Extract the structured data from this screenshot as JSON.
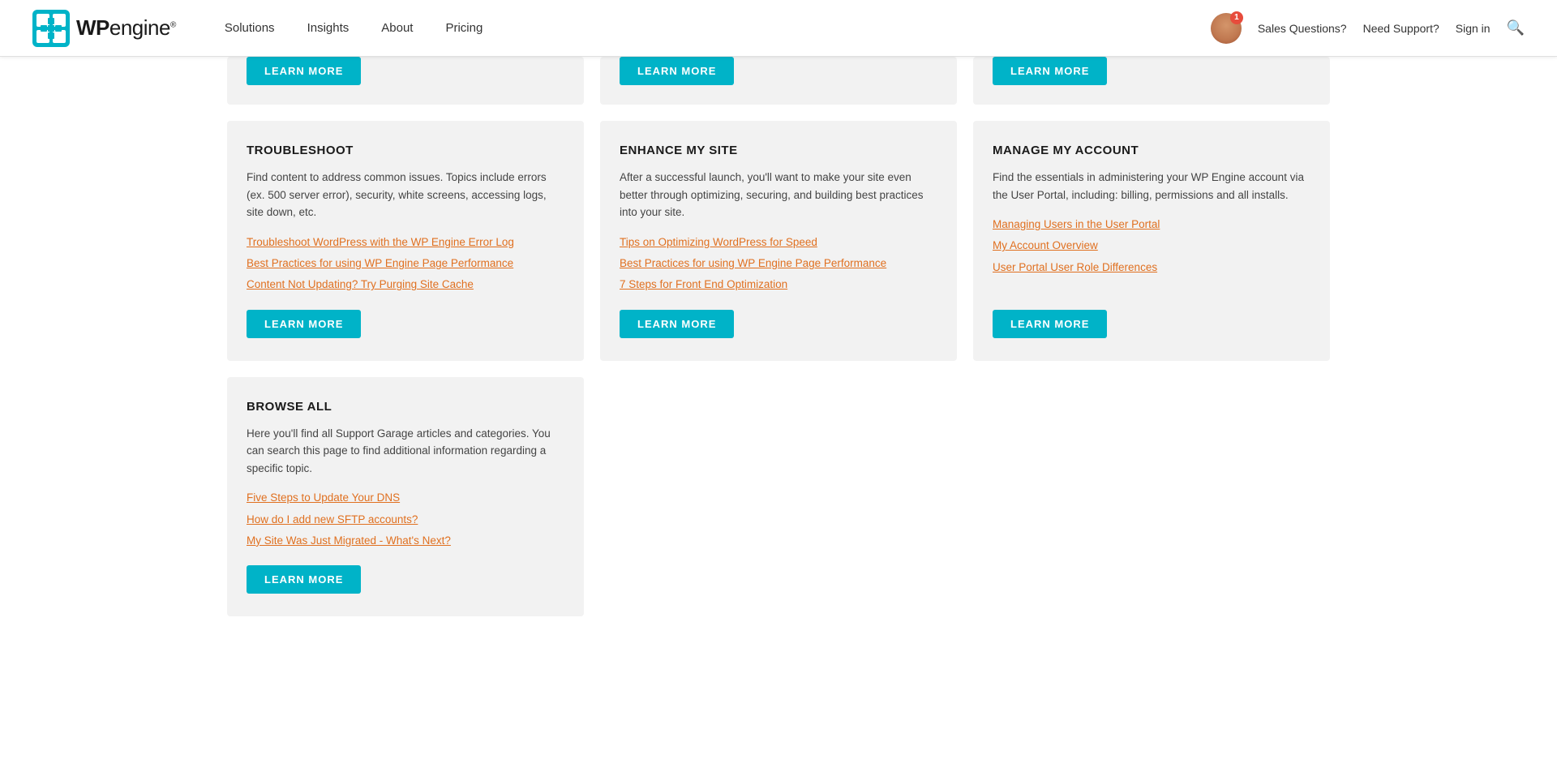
{
  "header": {
    "logo_text_wp": "WP",
    "logo_text_engine": "engine",
    "logo_tagline": "®",
    "nav": [
      {
        "label": "Solutions",
        "href": "#"
      },
      {
        "label": "Insights",
        "href": "#"
      },
      {
        "label": "About",
        "href": "#"
      },
      {
        "label": "Pricing",
        "href": "#"
      }
    ],
    "badge_count": "1",
    "sales_questions": "Sales Questions?",
    "need_support": "Need Support?",
    "sign_in": "Sign in"
  },
  "partial_cards": [
    {
      "btn_label": "LEARN MORE"
    },
    {
      "btn_label": "LEARN MORE"
    },
    {
      "btn_label": "LEARN MORE"
    }
  ],
  "cards": [
    {
      "id": "troubleshoot",
      "title": "TROUBLESHOOT",
      "desc": "Find content to address common issues. Topics include errors (ex. 500 server error), security, white screens, accessing logs, site down, etc.",
      "links": [
        "Troubleshoot WordPress with the WP Engine Error Log",
        "Best Practices for using WP Engine Page Performance",
        "Content Not Updating? Try Purging Site Cache"
      ],
      "btn": "LEARN MORE"
    },
    {
      "id": "enhance",
      "title": "ENHANCE MY SITE",
      "desc": "After a successful launch, you'll want to make your site even better through optimizing, securing, and building best practices into your site.",
      "links": [
        "Tips on Optimizing WordPress for Speed",
        "Best Practices for using WP Engine Page Performance",
        "7 Steps for Front End Optimization"
      ],
      "btn": "LEARN MORE"
    },
    {
      "id": "manage",
      "title": "MANAGE MY ACCOUNT",
      "desc": "Find the essentials in administering your WP Engine account via the User Portal, including: billing, permissions and all installs.",
      "links": [
        "Managing Users in the User Portal",
        "My Account Overview",
        "User Portal User Role Differences"
      ],
      "btn": "LEARN MORE"
    }
  ],
  "browse_all": {
    "title": "BROWSE ALL",
    "desc": "Here you'll find all Support Garage articles and categories. You can search this page to find additional information regarding a specific topic.",
    "links": [
      "Five Steps to Update Your DNS",
      "How do I add new SFTP accounts?",
      "My Site Was Just Migrated - What's Next?"
    ],
    "btn": "LEARN MORE"
  }
}
